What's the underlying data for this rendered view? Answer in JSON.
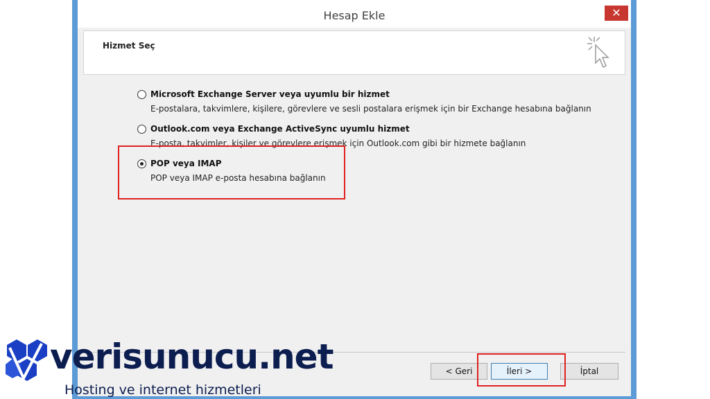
{
  "window": {
    "title": "Hesap Ekle",
    "close_glyph": "✕"
  },
  "header": {
    "title": "Hizmet Seç",
    "icon": "wizard-cursor-icon"
  },
  "options": [
    {
      "label": "Microsoft Exchange Server veya uyumlu bir hizmet",
      "description": "E-postalara, takvimlere, kişilere, görevlere ve sesli postalara erişmek için bir Exchange hesabına bağlanın",
      "selected": false
    },
    {
      "label": "Outlook.com veya Exchange ActiveSync uyumlu hizmet",
      "description": "E-posta, takvimler, kişiler ve görevlere erişmek için Outlook.com gibi bir hizmete bağlanın",
      "selected": false
    },
    {
      "label": "POP veya IMAP",
      "description": "POP veya IMAP e-posta hesabına bağlanın",
      "selected": true
    }
  ],
  "buttons": {
    "back": "< Geri",
    "next": "İleri >",
    "cancel": "İptal"
  },
  "brand": {
    "name": "verisunucu.net",
    "tagline": "Hosting ve internet hizmetleri"
  },
  "colors": {
    "window_border": "#5c9bd6",
    "close": "#c7372f",
    "highlight": "#e02020",
    "brand": "#0c1d4f"
  }
}
